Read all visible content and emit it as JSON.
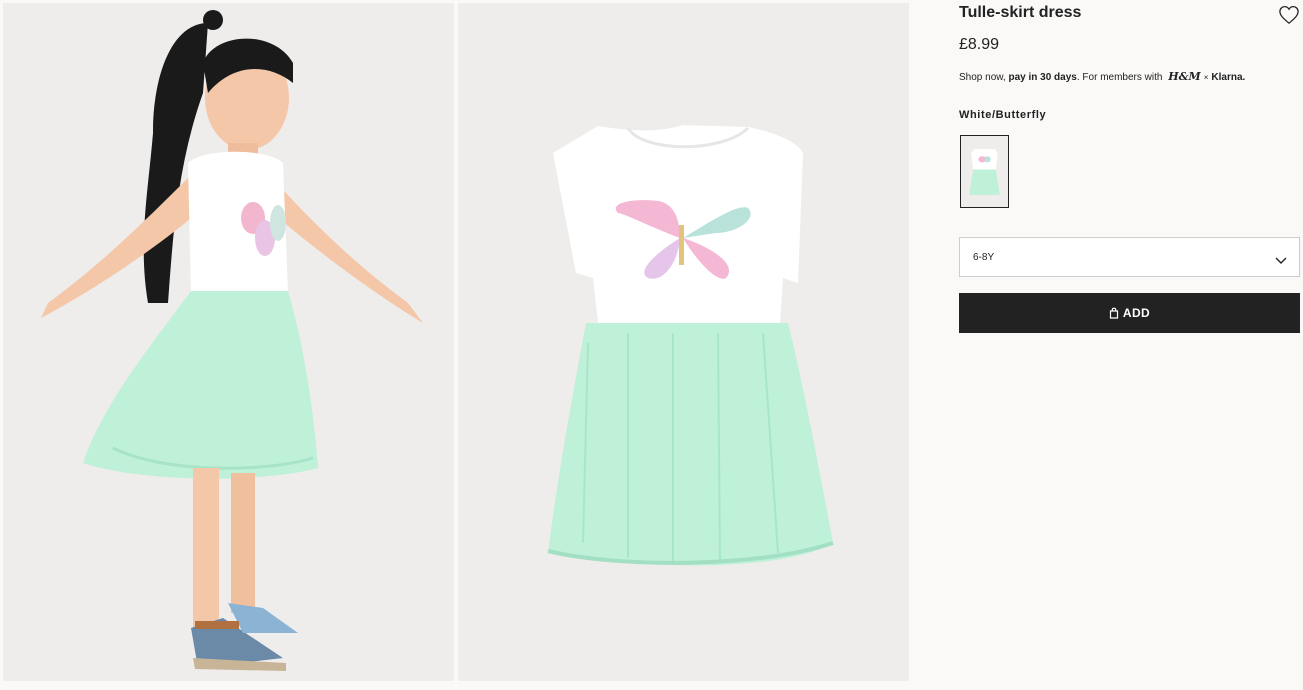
{
  "product": {
    "name": "Tulle-skirt dress",
    "price": "£8.99",
    "klarna": {
      "prefix": "Shop now, ",
      "emphasis": "pay in 30 days",
      "middle": ". For members with ",
      "brand": "H&M",
      "times": "×",
      "partner": "Klarna."
    },
    "colour_name": "White/Butterfly",
    "selected_size": "6-8Y",
    "add_label": "ADD"
  },
  "icons": {
    "favourite": "heart-outline-icon",
    "size_dropdown": "chevron-down-icon",
    "add": "shopping-bag-icon"
  },
  "colors": {
    "button_bg": "#222222",
    "page_bg": "#faf9f8",
    "photo_bg": "#eeedec",
    "skirt": "#bff0d8"
  }
}
